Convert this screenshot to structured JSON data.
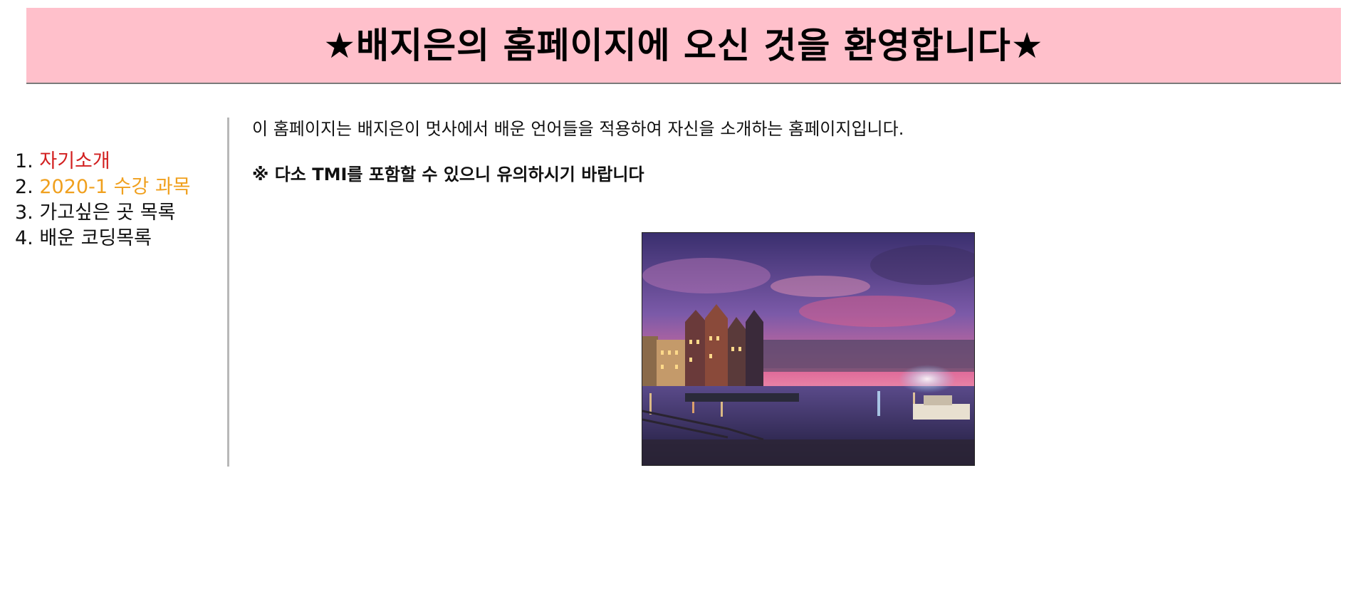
{
  "header": {
    "title": "★배지은의 홈페이지에 오신 것을 환영합니다★",
    "background": "#ffc0cb"
  },
  "sidebar": {
    "items": [
      {
        "number": "1.",
        "label": "자기소개",
        "color": "#d21f1f"
      },
      {
        "number": "2.",
        "label": "2020-1 수강 과목",
        "color": "#f0a01e"
      },
      {
        "number": "3.",
        "label": "가고싶은 곳 목록",
        "color": "#111111"
      },
      {
        "number": "4.",
        "label": "배운 코딩목록",
        "color": "#111111"
      }
    ]
  },
  "main": {
    "intro": "이 홈페이지는 배지은이 멋사에서 배운 언어들을 적용하여 자신을 소개하는 홈페이지입니다.",
    "warning": "※ 다소 TMI를 포함할 수 있으니 유의하시기 바랍니다"
  }
}
